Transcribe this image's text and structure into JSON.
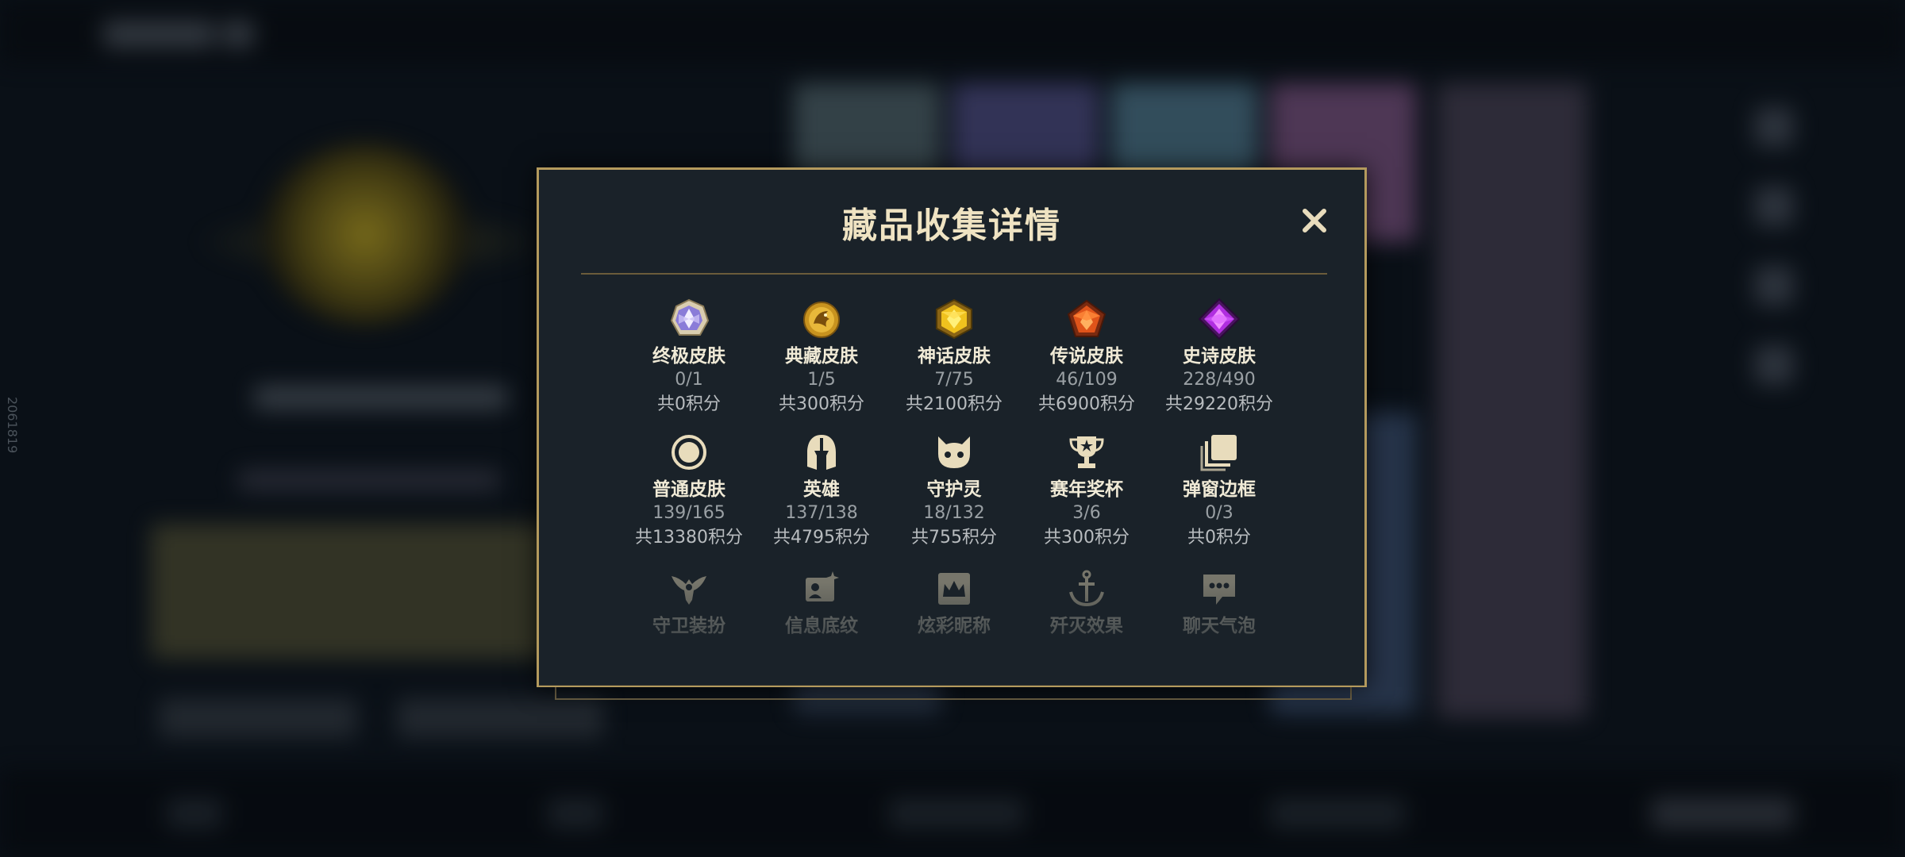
{
  "background": {
    "side_code": "2061819"
  },
  "modal": {
    "title": "藏品收集详情",
    "close_icon": "close-icon"
  },
  "items": [
    {
      "label": "终极皮肤",
      "count": "0/1",
      "points": "共0积分",
      "icon": "ultimate-gem-icon"
    },
    {
      "label": "典藏皮肤",
      "count": "1/5",
      "points": "共300积分",
      "icon": "dragon-medallion-icon"
    },
    {
      "label": "神话皮肤",
      "count": "7/75",
      "points": "共2100积分",
      "icon": "mythic-gem-icon"
    },
    {
      "label": "传说皮肤",
      "count": "46/109",
      "points": "共6900积分",
      "icon": "legendary-gem-icon"
    },
    {
      "label": "史诗皮肤",
      "count": "228/490",
      "points": "共29220积分",
      "icon": "epic-gem-icon"
    },
    {
      "label": "普通皮肤",
      "count": "139/165",
      "points": "共13380积分",
      "icon": "ring-icon"
    },
    {
      "label": "英雄",
      "count": "137/138",
      "points": "共4795积分",
      "icon": "helmet-icon"
    },
    {
      "label": "守护灵",
      "count": "18/132",
      "points": "共755积分",
      "icon": "guardian-pet-icon"
    },
    {
      "label": "赛年奖杯",
      "count": "3/6",
      "points": "共300积分",
      "icon": "trophy-icon"
    },
    {
      "label": "弹窗边框",
      "count": "0/3",
      "points": "共0积分",
      "icon": "frame-stack-icon"
    },
    {
      "label": "守卫装扮",
      "icon": "ward-skin-icon"
    },
    {
      "label": "信息底纹",
      "icon": "card-sparkle-icon"
    },
    {
      "label": "炫彩昵称",
      "icon": "crown-card-icon"
    },
    {
      "label": "歼灭效果",
      "icon": "anchor-icon"
    },
    {
      "label": "聊天气泡",
      "icon": "chat-bubble-icon"
    }
  ],
  "colors": {
    "modal_bg": "#1a2229",
    "border_gold": "#b49a5d",
    "label": "#f0ead6",
    "muted": "#9aa0a4"
  }
}
